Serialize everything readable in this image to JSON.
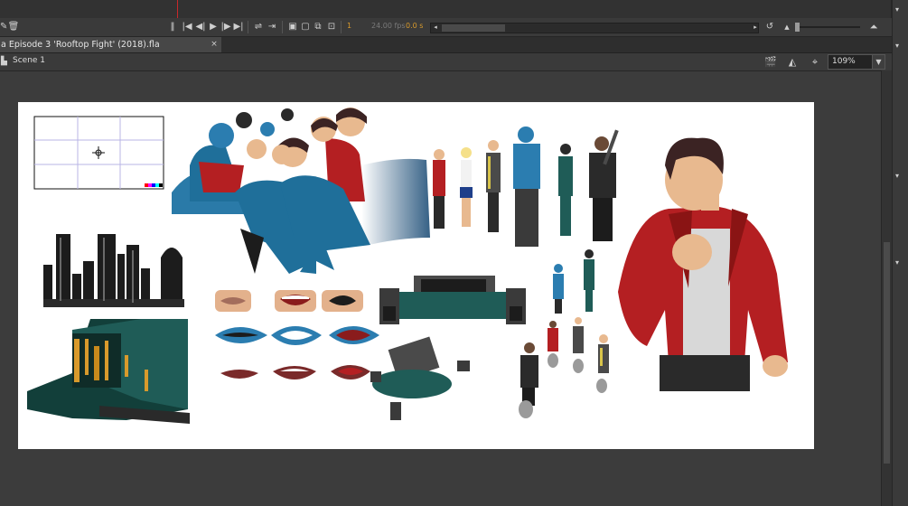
{
  "timeline": {
    "frame_number": "1",
    "fps": "24.00 fps",
    "time": "0.0 s",
    "icons": [
      "play-first-icon",
      "step-back-icon",
      "play-icon",
      "step-forward-icon",
      "play-last-icon",
      "loop-icon",
      "center-frame-icon",
      "onion-skin-icon",
      "onion-outline-icon",
      "edit-multiple-icon",
      "onion-markers-icon",
      "undo-icon"
    ]
  },
  "document": {
    "tab_label": "a Episode 3 'Rooftop Fight' (2018).fla",
    "close_label": "×"
  },
  "scene": {
    "label": "Scene 1",
    "zoom": "109%",
    "zoom_dropdown": "▼"
  },
  "stage": {
    "background": "#ffffff",
    "assets": [
      "camera-frame",
      "city-skyline",
      "teal-building",
      "character-crowd",
      "mouth-chart",
      "hovercraft",
      "hovercraft-small",
      "lineup-characters",
      "small-characters",
      "hero-red-jacket"
    ]
  },
  "colors": {
    "app_bg": "#3c3c3c",
    "panel": "#3a3a3a",
    "accent_orange": "#d89a2c",
    "playhead": "#c8282a",
    "teal": "#1f5c57",
    "jacket_red": "#b41f22"
  }
}
